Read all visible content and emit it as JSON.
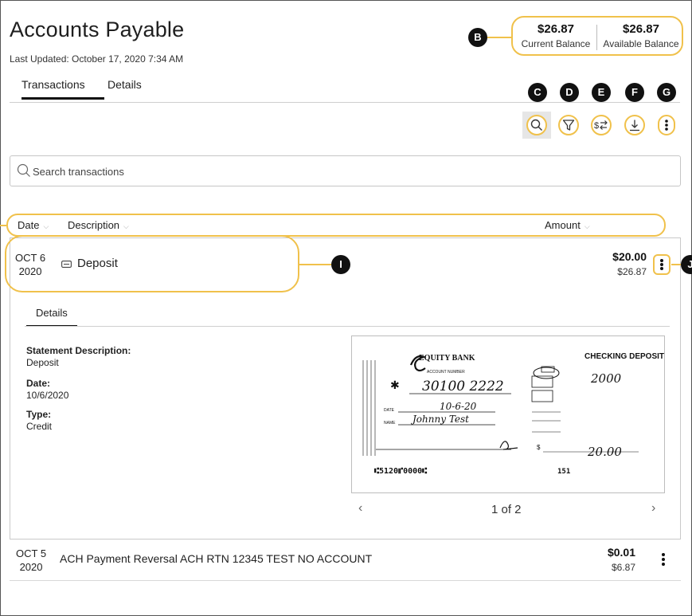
{
  "page": {
    "title": "Accounts Payable",
    "last_updated": "Last Updated: October 17, 2020 7:34 AM"
  },
  "tabs": [
    {
      "label": "Transactions",
      "active": true
    },
    {
      "label": "Details",
      "active": false
    }
  ],
  "balances": {
    "current_amount": "$26.87",
    "current_label": "Current Balance",
    "available_amount": "$26.87",
    "available_label": "Available Balance"
  },
  "callouts": {
    "b": "B",
    "c": "C",
    "d": "D",
    "e": "E",
    "f": "F",
    "g": "G",
    "i": "I",
    "j": "J"
  },
  "toolbar": {
    "icons": [
      "search-icon",
      "filter-icon",
      "transfer-icon",
      "download-icon",
      "more-icon"
    ]
  },
  "search": {
    "placeholder": "Search transactions"
  },
  "columns": {
    "date": "Date",
    "description": "Description",
    "amount": "Amount"
  },
  "transactions": [
    {
      "date_md": "OCT 6",
      "date_year": "2020",
      "description": "Deposit",
      "amount": "$20.00",
      "balance": "$26.87",
      "expanded": true,
      "details": {
        "tab_label": "Details",
        "statement_description_label": "Statement Description:",
        "statement_description": "Deposit",
        "date_label": "Date:",
        "date": "10/6/2020",
        "type_label": "Type:",
        "type": "Credit"
      },
      "check_image": {
        "bank_name": "EQUITY BANK",
        "heading": "CHECKING DEPOSIT",
        "account_number_label": "ACCOUNT NUMBER",
        "account_number": "30100 2222",
        "date_label": "DATE",
        "date": "10-6-20",
        "name_label": "NAME",
        "name": "Johnny Test",
        "cash": "2000",
        "total": "20.00",
        "micr": "⑆5120⑈0000⑆",
        "micr_right": "151",
        "pager": "1 of 2"
      }
    },
    {
      "date_md": "OCT 5",
      "date_year": "2020",
      "description": "ACH Payment Reversal ACH RTN 12345 TEST NO ACCOUNT",
      "amount": "$0.01",
      "balance": "$6.87",
      "expanded": false
    }
  ],
  "colors": {
    "accent": "#f0c14b",
    "callout": "#111111"
  }
}
